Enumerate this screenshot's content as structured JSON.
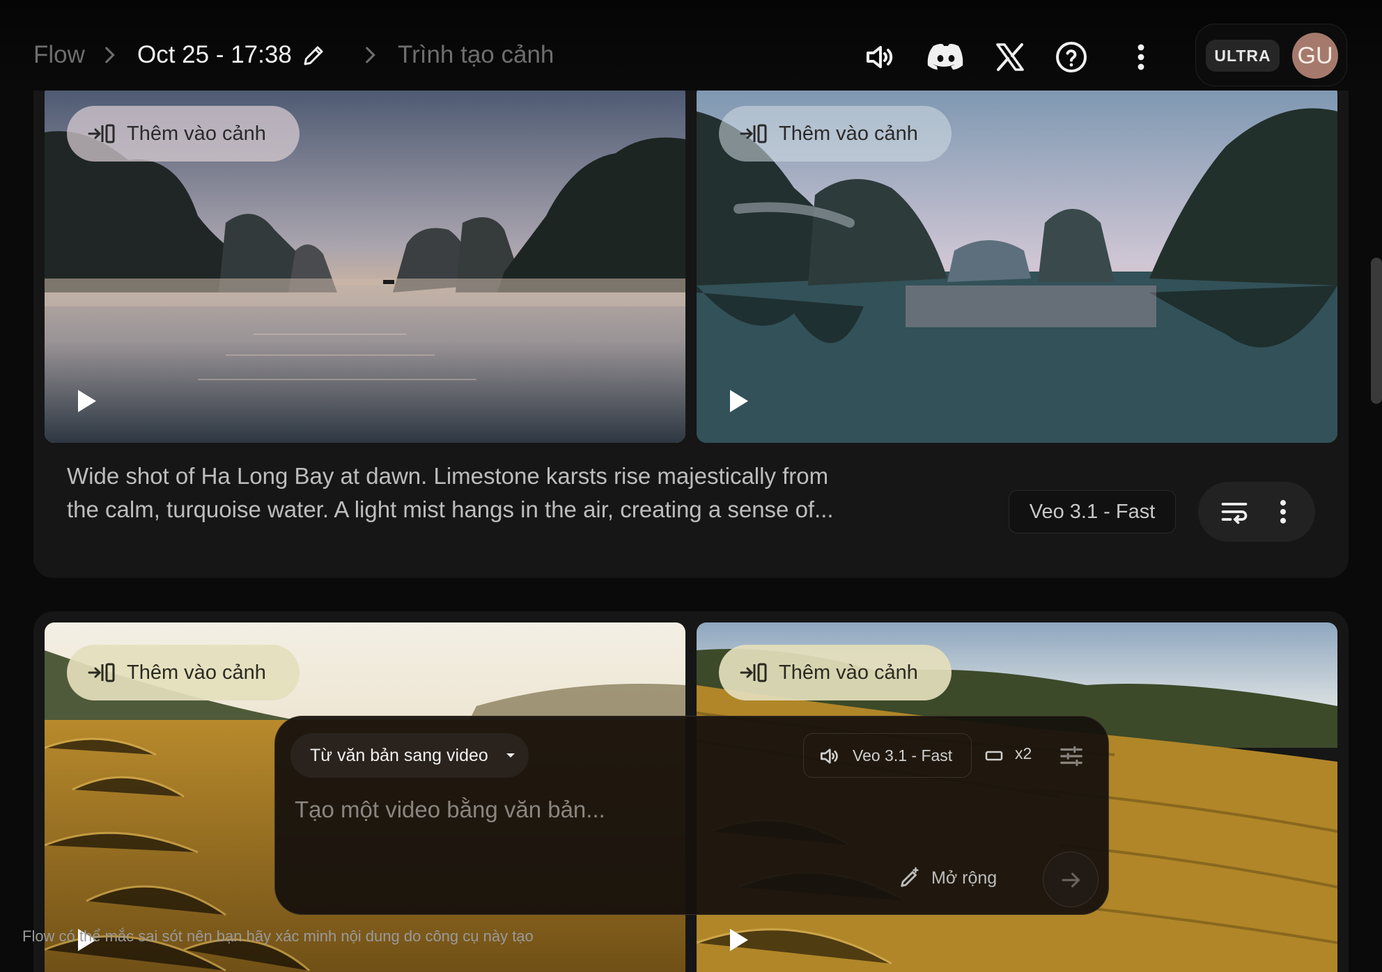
{
  "header": {
    "breadcrumb_root": "Flow",
    "project_title": "Oct 25 - 17:38",
    "current_page": "Trình tạo cảnh",
    "icons": [
      "volume-icon",
      "discord-icon",
      "x-logo-icon",
      "help-icon",
      "more-vert-icon"
    ],
    "plan_badge": "ULTRA",
    "avatar_initials": "GU",
    "avatar_color": "#a57a6c"
  },
  "cards": [
    {
      "clips": [
        {
          "add_label": "Thêm vào cảnh",
          "scene": "Ha Long Bay at dawn, misty water, limestone karsts"
        },
        {
          "add_label": "Thêm vào cảnh",
          "scene": "Limestone karsts reflected in calm water at dusk"
        }
      ],
      "prompt": "Wide shot of Ha Long Bay at dawn. Limestone karsts rise majestically from the calm, turquoise water. A light mist hangs in the air, creating a sense of...",
      "model": "Veo 3.1 - Fast"
    },
    {
      "clips": [
        {
          "add_label": "Thêm vào cảnh",
          "scene": "Golden rice terraces at sunrise"
        },
        {
          "add_label": "Thêm vào cảnh",
          "scene": "Golden terraced rice fields on hillside"
        }
      ]
    }
  ],
  "composer": {
    "mode": "Từ văn bản sang video",
    "model": "Veo 3.1 - Fast",
    "count": "x2",
    "placeholder": "Tạo một video bằng văn bản...",
    "expand_label": "Mở rộng"
  },
  "disclaimer": "Flow có thể mắc sai sót nên bạn hãy xác minh nội dung do công cụ này tạo",
  "colors": {
    "background": "#0a0a0a",
    "card": "#161616",
    "composer": "#16110d",
    "pill_light": "#dacdd2",
    "pill_cream": "#e4debc"
  }
}
